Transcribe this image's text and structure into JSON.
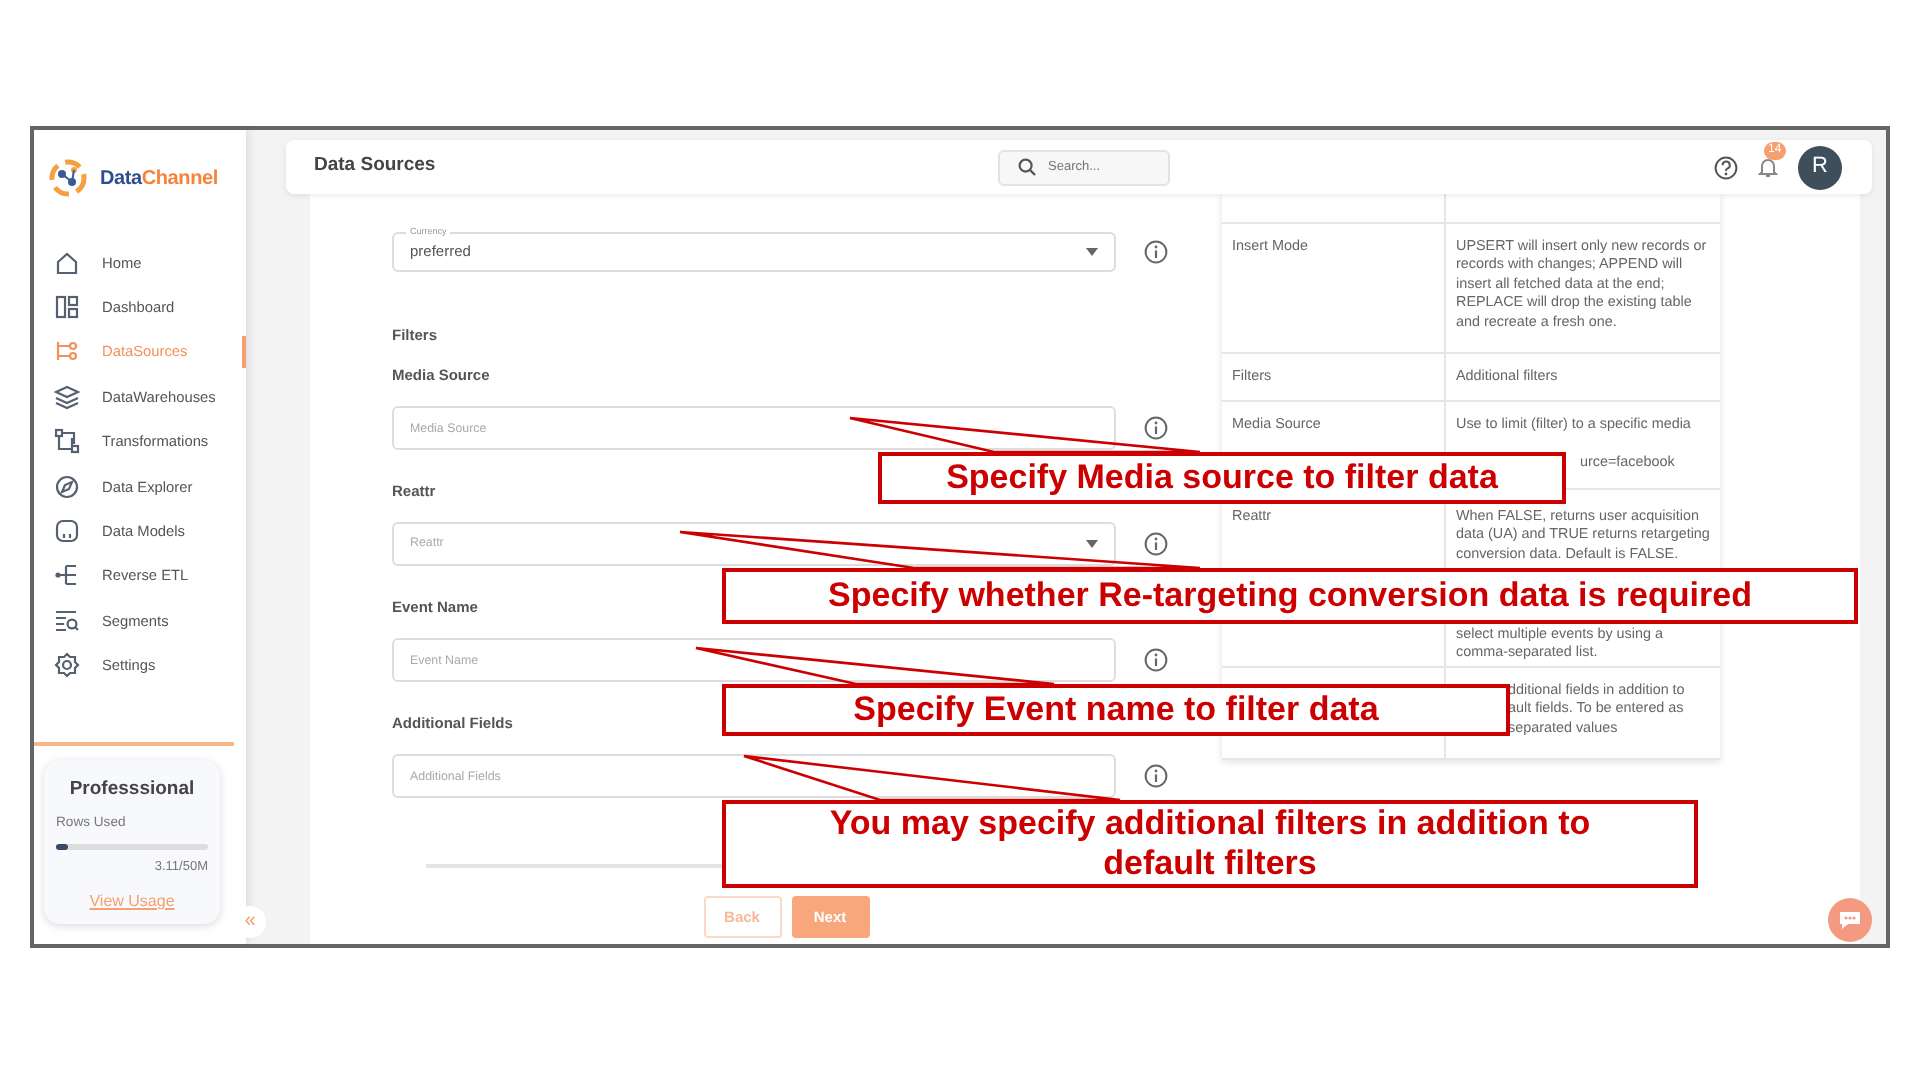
{
  "sidebar": {
    "brand": [
      "Data",
      "Channel"
    ],
    "items": [
      {
        "label": "Home",
        "selected": false
      },
      {
        "label": "Dashboard",
        "selected": false
      },
      {
        "label": "DataSources",
        "selected": true
      },
      {
        "label": "DataWarehouses",
        "selected": false
      },
      {
        "label": "Transformations",
        "selected": false
      },
      {
        "label": "Data Explorer",
        "selected": false
      },
      {
        "label": "Data Models",
        "selected": false
      },
      {
        "label": "Reverse ETL",
        "selected": false
      },
      {
        "label": "Segments",
        "selected": false
      },
      {
        "label": "Settings",
        "selected": false
      }
    ],
    "plan": {
      "name": "Professsional",
      "usage_label": "Rows Used",
      "level": 0.08,
      "usage": "3.11/50M",
      "link": "View Usage"
    },
    "collapse": "«"
  },
  "header": {
    "title": "Data Sources",
    "search": {
      "placeholder": "Search..."
    },
    "notifications": "14",
    "avatar": "R"
  },
  "form": {
    "items": [
      {
        "kind": "select",
        "floating_label": "Currency",
        "value": "preferred"
      },
      {
        "kind": "heading",
        "label": "Filters"
      },
      {
        "kind": "input",
        "label": "Media Source",
        "placeholder": "Media Source"
      },
      {
        "kind": "select",
        "label": "Reattr",
        "placeholder": "Reattr"
      },
      {
        "kind": "input",
        "label": "Event Name",
        "placeholder": "Event Name"
      },
      {
        "kind": "input",
        "label": "Additional Fields",
        "placeholder": "Additional Fields"
      }
    ],
    "buttons": [
      {
        "label": "Back",
        "kind": "secondary"
      },
      {
        "label": "Next",
        "kind": "primary"
      }
    ]
  },
  "table": {
    "rows": [
      {
        "parameter": "Insert Mode",
        "description": [
          "UPSERT will insert only new records or",
          "records with changes; APPEND will",
          "insert all fetched data at the end;",
          "REPLACE will drop the existing table",
          "and recreate a fresh one."
        ]
      },
      {
        "parameter": "Filters",
        "description": [
          "Additional filters"
        ]
      },
      {
        "parameter": "Media Source",
        "description": [
          "Use to limit (filter) to a specific media",
          "urce=facebook"
        ]
      },
      {
        "parameter": "Reattr",
        "description": [
          "When FALSE, returns user acquisition",
          "data (UA) and TRUE returns retargeting",
          "conversion data. Default is FALSE."
        ]
      },
      {
        "description": [
          "select multiple events by using a",
          "comma-separated list."
        ]
      },
      {
        "description": [
          "dditional fields in addition to",
          "ault fields. To be entered as",
          "separated values"
        ]
      }
    ]
  },
  "callouts": [
    {
      "text": "Specify Media source to filter data"
    },
    {
      "text": "Specify whether Re-targeting conversion data is required"
    },
    {
      "text": "Specify Event name to filter data"
    },
    {
      "text": "You may specify additional filters in addition to default filters"
    }
  ]
}
